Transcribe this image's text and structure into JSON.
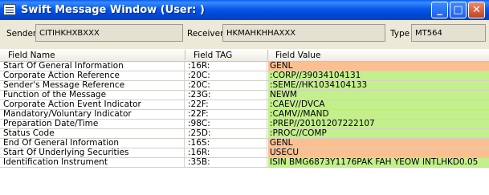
{
  "window": {
    "title": "Swift Message Window (User: )",
    "controls": {
      "minimize": "_",
      "maximize": "□",
      "close": "✕"
    }
  },
  "header": {
    "sender_label": "Sender",
    "sender_value": "CITIHKHXBXXX",
    "receiver_label": "Receiver",
    "receiver_value": "HKMAHKHHAXXX",
    "type_label": "Type",
    "type_value": "MT564"
  },
  "table": {
    "columns": [
      "Field Name",
      "Field TAG",
      "Field Value"
    ],
    "rows": [
      {
        "name": "Start Of General Information",
        "tag": ":16R:",
        "value": "GENL",
        "color": "#FCC090"
      },
      {
        "name": "Corporate Action Reference",
        "tag": ":20C:",
        "value": ":CORP//39034104131",
        "color": "#C3F08A"
      },
      {
        "name": "Sender's Message Reference",
        "tag": ":20C:",
        "value": ":SEME//HK1034104133",
        "color": "#C3F08A"
      },
      {
        "name": "Function of the Message",
        "tag": ":23G:",
        "value": "NEWM",
        "color": "#C3F08A"
      },
      {
        "name": "Corporate Action Event Indicator",
        "tag": ":22F:",
        "value": ":CAEV//DVCA",
        "color": "#C3F08A"
      },
      {
        "name": "Mandatory/Voluntary Indicator",
        "tag": ":22F:",
        "value": ":CAMV//MAND",
        "color": "#C3F08A"
      },
      {
        "name": "Preparation Date/Time",
        "tag": ":98C:",
        "value": ":PREP//20101207222107",
        "color": "#C3F08A"
      },
      {
        "name": "Status Code",
        "tag": ":25D:",
        "value": ":PROC//COMP",
        "color": "#C3F08A"
      },
      {
        "name": "End Of General Information",
        "tag": ":16S:",
        "value": "GENL",
        "color": "#FCC090"
      },
      {
        "name": "Start Of Underlying Securities",
        "tag": ":16R:",
        "value": "USECU",
        "color": "#FCC090"
      },
      {
        "name": "Identification Instrument",
        "tag": ":35B:",
        "value": "ISIN BMG6873Y1176PAK FAH YEOW INTLHKD0.05",
        "color": "#C3F08A"
      }
    ]
  }
}
